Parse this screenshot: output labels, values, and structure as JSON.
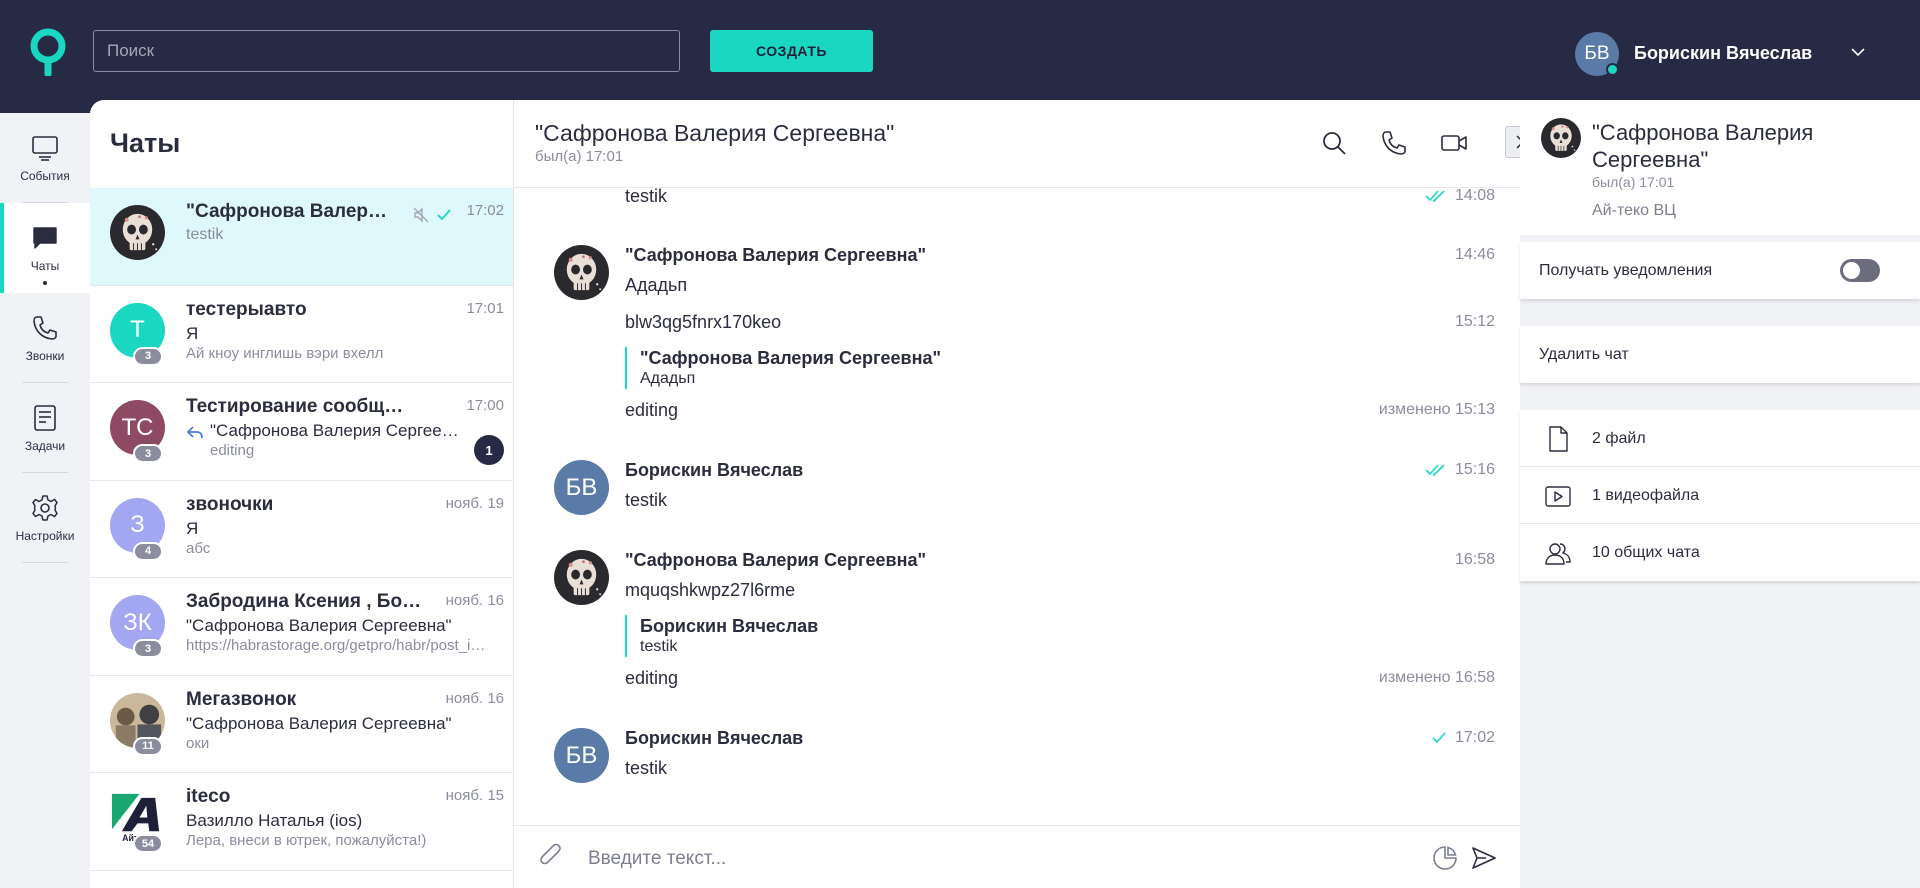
{
  "topbar": {
    "search_placeholder": "Поиск",
    "create_label": "СОЗДАТЬ",
    "user_initials": "БВ",
    "user_name": "Борискин Вячеслав",
    "accent_color": "#19d7c1",
    "bg_color": "#272a44"
  },
  "nav": {
    "items": [
      {
        "label": "События",
        "icon": "monitor-icon"
      },
      {
        "label": "Чаты",
        "icon": "chat-bubble-icon"
      },
      {
        "label": "Звонки",
        "icon": "phone-icon"
      },
      {
        "label": "Задачи",
        "icon": "task-list-icon"
      },
      {
        "label": "Настройки",
        "icon": "gear-icon"
      }
    ]
  },
  "chatlist": {
    "title": "Чаты",
    "items": [
      {
        "name": "\"Сафронова Валерия Сергеевна\"",
        "time": "17:02",
        "line1": "testik",
        "line2": "",
        "badge": "",
        "initials": "",
        "unread": ""
      },
      {
        "name": "тестерыавто",
        "time": "17:01",
        "line1": "Я",
        "line2": "Ай кноу инглишь вэри вхелл",
        "badge": "3",
        "initials": "Т",
        "unread": ""
      },
      {
        "name": "Тестирование сообщений",
        "time": "17:00",
        "line1": "\"Сафронова Валерия Сергеевна\"",
        "line2": "editing",
        "badge": "3",
        "initials": "ТС",
        "unread": "1"
      },
      {
        "name": "звоночки",
        "time": "нояб. 19",
        "line1": "Я",
        "line2": "абс",
        "badge": "4",
        "initials": "З",
        "unread": ""
      },
      {
        "name": "Забродина Ксения , Борискин Вячеслав",
        "time": "нояб. 16",
        "line1": "\"Сафронова Валерия Сергеевна\"",
        "line2": "https://habrastorage.org/getpro/habr/post_images",
        "badge": "3",
        "initials": "ЗК",
        "unread": ""
      },
      {
        "name": "Мегазвонок",
        "time": "нояб. 16",
        "line1": "\"Сафронова Валерия Сергеевна\"",
        "line2": "оки",
        "badge": "11",
        "initials": "",
        "unread": ""
      },
      {
        "name": "iteco",
        "time": "нояб. 15",
        "line1": "Вазилло Наталья (ios)",
        "line2": "Лера, внеси в ютрек, пожалуйста!)",
        "badge": "54",
        "initials": "",
        "unread": ""
      }
    ]
  },
  "conversation": {
    "title": "\"Сафронова Валерия Сергеевна\"",
    "subtitle": "был(а) 17:01",
    "composer_placeholder": "Введите текст...",
    "top_partial": {
      "text": "testik",
      "time": "14:08"
    },
    "group1": {
      "sender": "\"Сафронова Валерия Сергеевна\"",
      "time": "14:46",
      "text": "Ададьп",
      "msg2_text": "blw3qg5fnrx170keo",
      "msg2_time": "15:12",
      "quote_name": "\"Сафронова Валерия Сергеевна\"",
      "quote_text": "Ададьп",
      "msg3_text": "editing",
      "msg3_time": "изменено 15:13"
    },
    "group2": {
      "initials": "БВ",
      "sender": "Борискин Вячеслав",
      "time": "15:16",
      "text": "testik"
    },
    "group3": {
      "sender": "\"Сафронова Валерия Сергеевна\"",
      "time": "16:58",
      "text": "mquqshkwpz27l6rme",
      "quote_name": "Борискин Вячеслав",
      "quote_text": "testik",
      "msg2_text": "editing",
      "msg2_time": "изменено 16:58"
    },
    "group4": {
      "initials": "БВ",
      "sender": "Борискин Вячеслав",
      "time": "17:02",
      "text": "testik"
    }
  },
  "rightpanel": {
    "name": "\"Сафронова Валерия Сергеевна\"",
    "status": "был(а) 17:01",
    "org": "Ай-теко ВЦ",
    "notifications_label": "Получать уведомления",
    "notifications_enabled": false,
    "delete_label": "Удалить чат",
    "files_label": "2 файл",
    "videos_label": "1 видеофайла",
    "common_chats_label": "10 общих чата"
  }
}
